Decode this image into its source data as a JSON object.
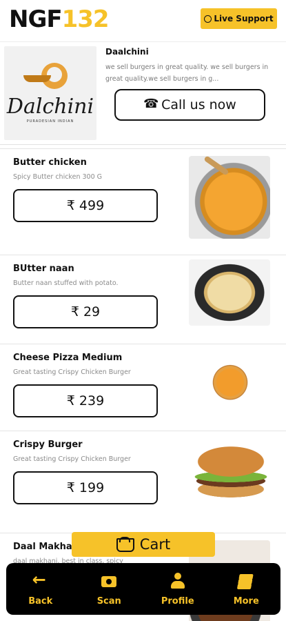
{
  "header": {
    "brand_part1": "NGF",
    "brand_part2": "132",
    "live_support_label": "Live Support"
  },
  "restaurant": {
    "name": "Daalchini",
    "logo_text": "Dalchini",
    "logo_subtext": "PURADESIAN INDIAN",
    "description": "we sell burgers in great quality. we sell burgers in great quality.we sell burgers in g...",
    "call_label": "Call us now"
  },
  "menu_items": [
    {
      "name": "Butter chicken",
      "description": "Spicy Butter chicken 300 G",
      "price": "₹ 499",
      "image": "butter-chicken-image"
    },
    {
      "name": "BUtter naan",
      "description": "Butter naan stuffed with potato.",
      "price": "₹ 29",
      "image": "butter-naan-image"
    },
    {
      "name": "Cheese Pizza Medium",
      "description": "Great tasting Crispy Chicken Burger",
      "price": "₹ 239",
      "image": "pizza-image"
    },
    {
      "name": "Crispy Burger",
      "description": "Great tasting Crispy Chicken Burger",
      "price": "₹ 199",
      "image": "burger-image"
    },
    {
      "name": "Daal Makhani",
      "description": "daal makhani, best in class, spicy",
      "image": "daal-makhani-image"
    }
  ],
  "cart": {
    "label": "Cart"
  },
  "bottom_nav": {
    "back": "Back",
    "scan": "Scan",
    "profile": "Profile",
    "more": "More"
  },
  "colors": {
    "accent": "#f6c229",
    "nav_background": "#000000",
    "text": "#111111",
    "muted_text": "#8a8a8a"
  }
}
